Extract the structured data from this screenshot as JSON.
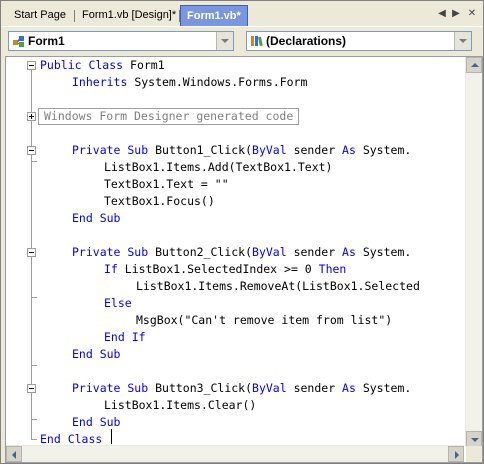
{
  "tabs": [
    {
      "label": "Start Page",
      "active": false
    },
    {
      "label": "Form1.vb [Design]*",
      "active": false
    },
    {
      "label": "Form1.vb*",
      "active": true
    }
  ],
  "tab_controls": {
    "prev": "◀",
    "next": "▶",
    "close": "✕"
  },
  "class_dropdown": {
    "value": "Form1",
    "icon": "class-icon"
  },
  "member_dropdown": {
    "value": "(Declarations)",
    "icon": "declarations-icon"
  },
  "code": {
    "l1": {
      "a": "Public Class ",
      "b": "Form1"
    },
    "l2": {
      "a": "Inherits ",
      "b": "System.Windows.Forms.Form"
    },
    "region_label": "Windows Form Designer generated code",
    "b1_sig": {
      "a": "Private Sub ",
      "b": "Button1_Click(",
      "c": "ByVal",
      "d": " sender ",
      "e": "As",
      "f": " System."
    },
    "b1_l1": "ListBox1.Items.Add(TextBox1.Text)",
    "b1_l2": "TextBox1.Text = \"\"",
    "b1_l3": "TextBox1.Focus()",
    "end_sub": "End Sub",
    "b2_sig": {
      "a": "Private Sub ",
      "b": "Button2_Click(",
      "c": "ByVal",
      "d": " sender ",
      "e": "As",
      "f": " System."
    },
    "b2_if": {
      "a": "If ",
      "b": "ListBox1.SelectedIndex >= 0 ",
      "c": "Then"
    },
    "b2_remove": "ListBox1.Items.RemoveAt(ListBox1.Selected",
    "else": "Else",
    "b2_msg": "MsgBox(\"Can't remove item from list\")",
    "end_if": "End If",
    "b3_sig": {
      "a": "Private Sub ",
      "b": "Button3_Click(",
      "c": "ByVal",
      "d": " sender ",
      "e": "As",
      "f": " System."
    },
    "b3_l1": "ListBox1.Items.Clear()",
    "end_class": "End Class"
  },
  "colors": {
    "keyword": "#0000ff",
    "text": "#000000",
    "active_tab": "#7a96df"
  }
}
